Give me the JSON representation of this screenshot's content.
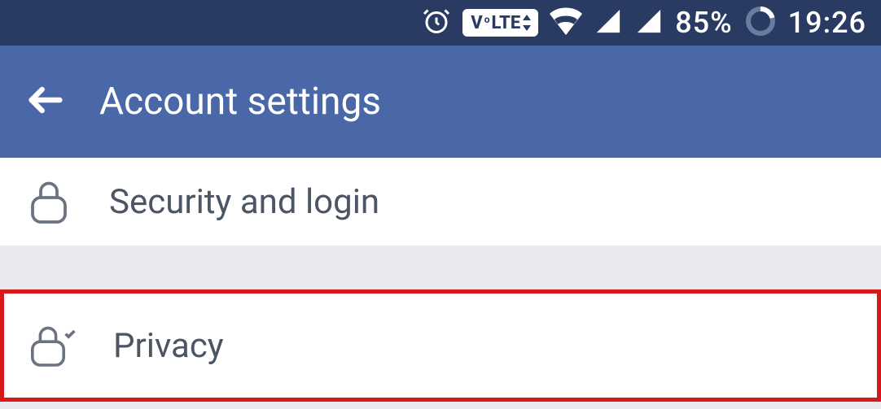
{
  "status": {
    "battery_percent": "85%",
    "time": "19:26"
  },
  "header": {
    "title": "Account settings"
  },
  "items": {
    "security": "Security and login",
    "privacy": "Privacy"
  },
  "colors": {
    "status_bg": "#2a3b63",
    "appbar_bg": "#4a67a8",
    "highlight_border": "#d8171a"
  }
}
